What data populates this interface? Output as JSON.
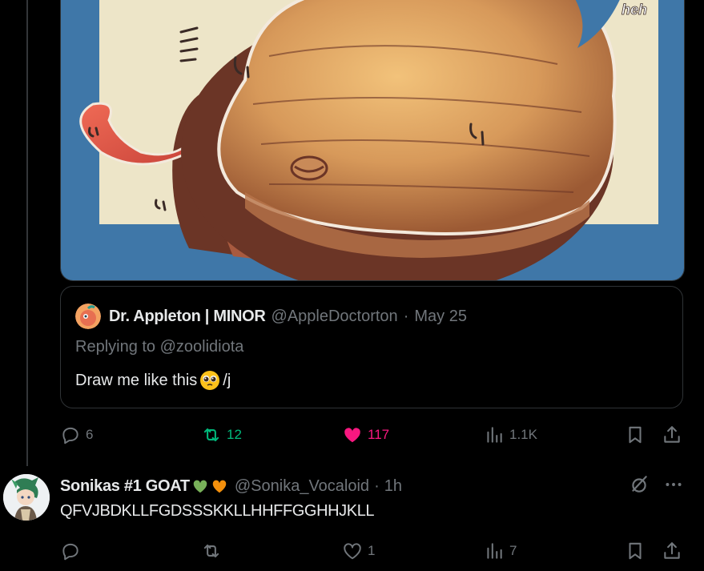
{
  "media": {
    "alt": "",
    "corner_text": "heh"
  },
  "quote": {
    "author_name": "Dr. Appleton | MINOR",
    "author_handle": "@AppleDoctorton",
    "dot": "·",
    "date": "May 25",
    "replying_prefix": "Replying to",
    "replying_to": "@zoolidiota",
    "text_before": "Draw me like this",
    "text_after": "/j"
  },
  "main_actions": {
    "replies": "6",
    "reposts": "12",
    "likes": "117",
    "views": "1.1K"
  },
  "reply": {
    "author_name": "Sonikas #1 GOAT",
    "author_handle": "@Sonika_Vocaloid",
    "dot": "·",
    "time": "1h",
    "text": "QFVJBDKLLFGDSSSKKLLHHFFGGHHJKLL",
    "actions": {
      "replies": "",
      "reposts": "",
      "likes": "1",
      "views": "7"
    }
  },
  "colors": {
    "background": "#000000",
    "text_primary": "#e7e9ea",
    "text_secondary": "#71767b",
    "repost_active": "#00ba7c",
    "like_active": "#f91880",
    "border": "#2f3336"
  }
}
